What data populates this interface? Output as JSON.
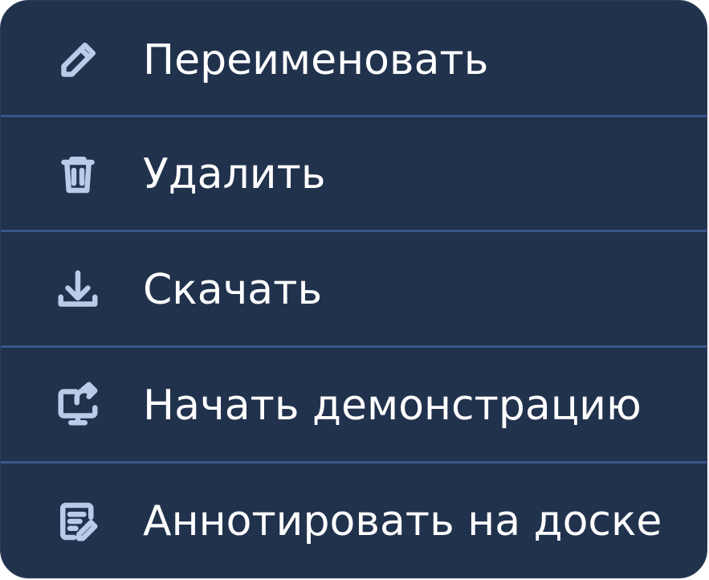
{
  "menu": {
    "items": [
      {
        "label": "Переименовать",
        "icon": "pencil-icon"
      },
      {
        "label": "Удалить",
        "icon": "trash-icon"
      },
      {
        "label": "Скачать",
        "icon": "download-icon"
      },
      {
        "label": "Начать демонстрацию",
        "icon": "screen-share-icon"
      },
      {
        "label": "Аннотировать на доске",
        "icon": "annotate-icon"
      }
    ]
  },
  "colors": {
    "background": "#21324d",
    "divider": "#37588a",
    "icon": "#b9cbe9",
    "text": "#ffffff"
  }
}
